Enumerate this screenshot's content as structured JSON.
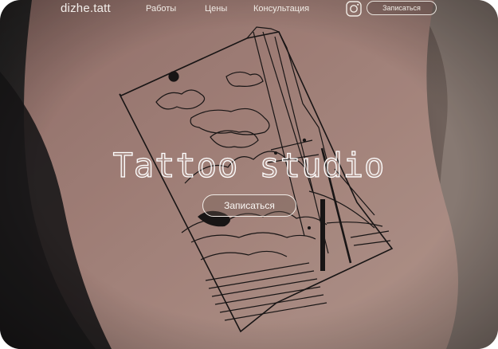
{
  "header": {
    "logo": "dizhe.tatt",
    "nav": [
      {
        "label": "Работы"
      },
      {
        "label": "Цены"
      },
      {
        "label": "Консультация"
      }
    ],
    "instagram_icon": "instagram-icon",
    "cta_label": "Записаться"
  },
  "hero": {
    "title": "Tattoo studio",
    "cta_label": "Записаться",
    "image": "tattoo-photo-forearm-landscape"
  },
  "colors": {
    "text": "#f1ece6",
    "skin": "#b78f85",
    "background_dark": "#2a2522"
  }
}
